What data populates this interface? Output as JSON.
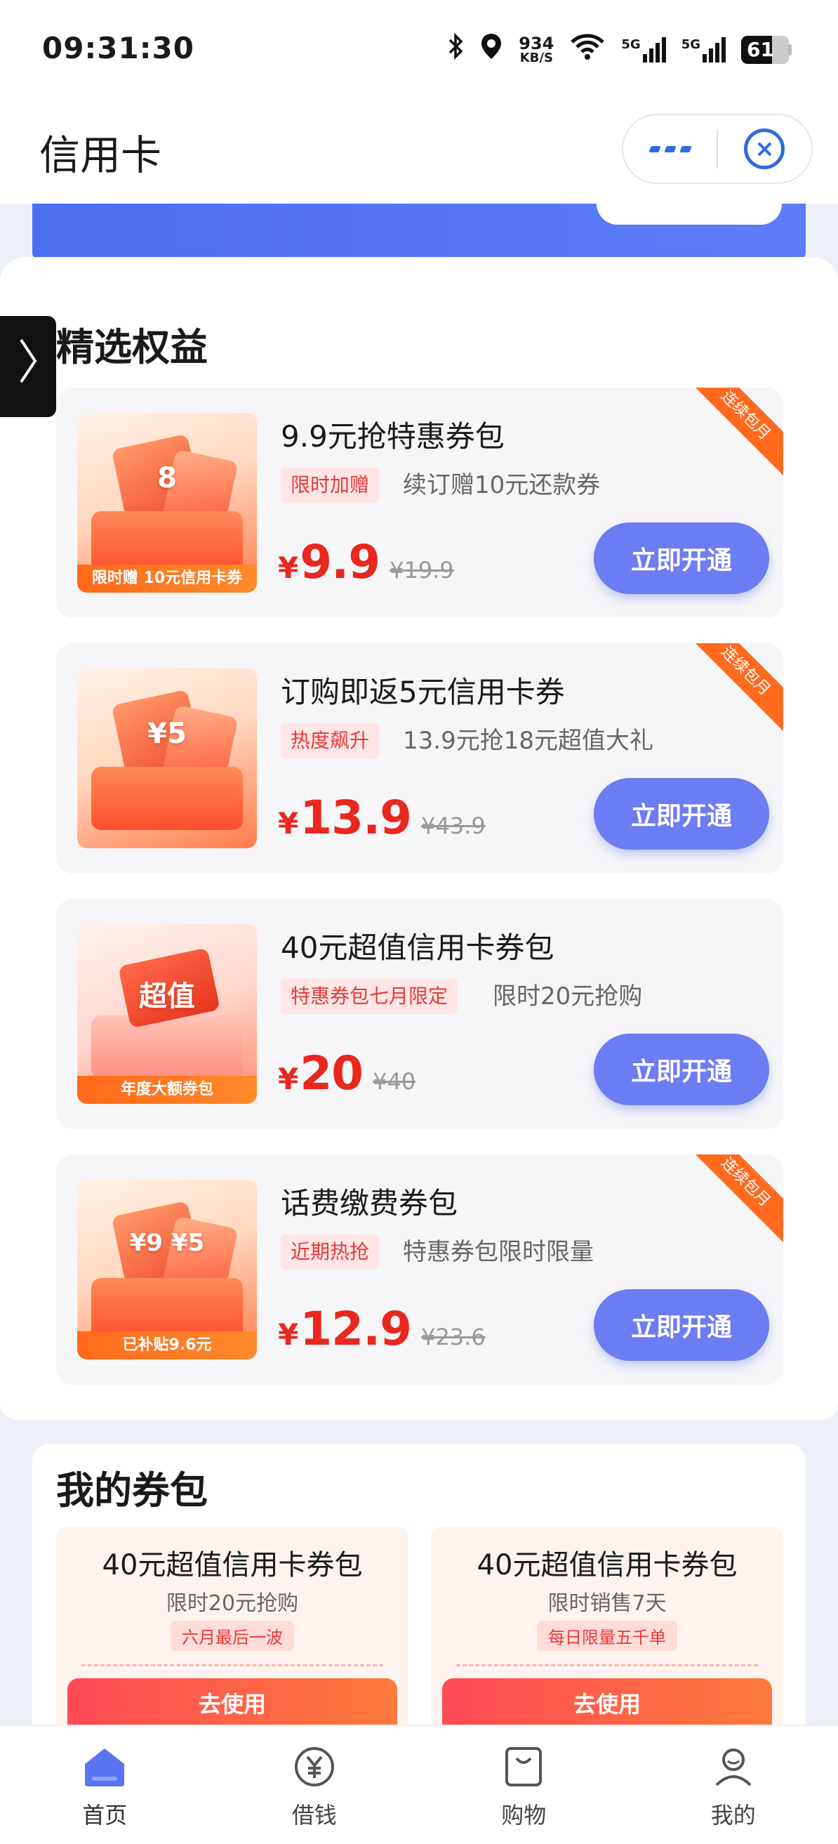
{
  "status": {
    "time": "09:31:30",
    "net_speed_value": "934",
    "net_speed_unit": "KB/S",
    "signal1": "5G",
    "signal2": "5G",
    "battery": "61"
  },
  "header": {
    "title": "信用卡"
  },
  "rights": {
    "section_title": "精选权益",
    "offers": [
      {
        "name": "9.9元抢特惠券包",
        "tag": "限时加赠",
        "desc": "续订赠10元还款券",
        "yen": "¥",
        "price": "9.9",
        "orig_price": "¥19.9",
        "button": "立即开通",
        "corner": "连续包月",
        "thumb_text": "8",
        "thumb_ribbon": "限时赠 10元信用卡券"
      },
      {
        "name": "订购即返5元信用卡券",
        "tag": "热度飙升",
        "desc": "13.9元抢18元超值大礼",
        "yen": "¥",
        "price": "13.9",
        "orig_price": "¥43.9",
        "button": "立即开通",
        "corner": "连续包月",
        "thumb_text": "¥5"
      },
      {
        "name": "40元超值信用卡券包",
        "tag": "特惠券包七月限定",
        "desc": "限时20元抢购",
        "yen": "¥",
        "price": "20",
        "orig_price": "¥40",
        "button": "立即开通",
        "thumb_text": "超值",
        "thumb_ribbon": "年度大额券包"
      },
      {
        "name": "话费缴费券包",
        "tag": "近期热抢",
        "desc": "特惠券包限时限量",
        "yen": "¥",
        "price": "12.9",
        "orig_price": "¥23.6",
        "button": "立即开通",
        "corner": "连续包月",
        "thumb_text": "¥9 ¥5",
        "thumb_ribbon": "已补贴9.6元"
      }
    ]
  },
  "coupons": {
    "section_title": "我的券包",
    "items": [
      {
        "name": "40元超值信用卡券包",
        "desc": "限时20元抢购",
        "tag": "六月最后一波",
        "button": "去使用"
      },
      {
        "name": "40元超值信用卡券包",
        "desc": "限时销售7天",
        "tag": "每日限量五千单",
        "button": "去使用"
      }
    ]
  },
  "tabbar": {
    "items": [
      {
        "label": "首页",
        "icon": "home-icon",
        "active": true
      },
      {
        "label": "借钱",
        "icon": "yen-circle-icon"
      },
      {
        "label": "购物",
        "icon": "shopping-bag-icon"
      },
      {
        "label": "我的",
        "icon": "user-icon"
      }
    ]
  },
  "colors": {
    "accent": "#6c7cf2",
    "price_red": "#e8271e",
    "corner_orange": "#ff6a1f",
    "tag_bg": "#ffe5e5"
  }
}
